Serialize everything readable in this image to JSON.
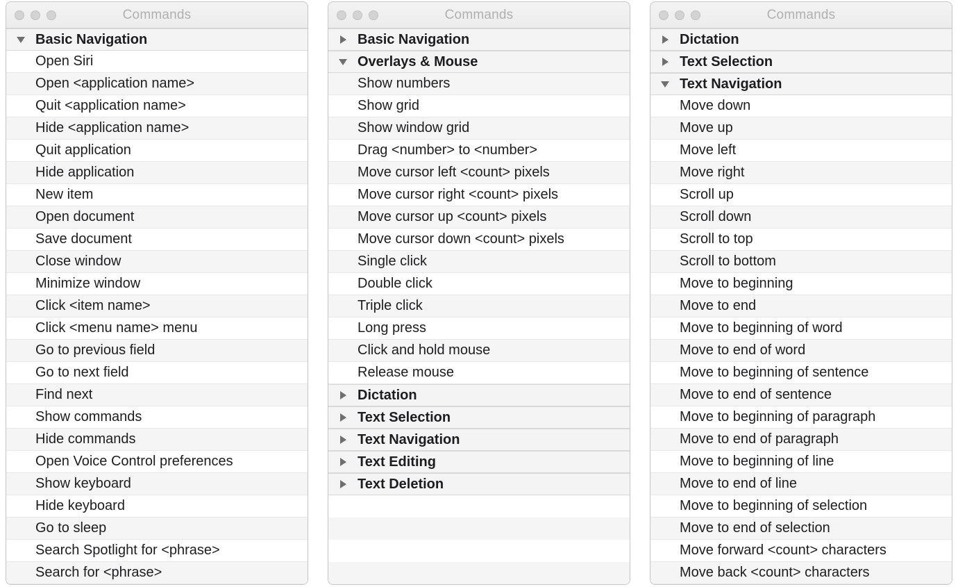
{
  "windowTitle": "Commands",
  "panels": [
    {
      "title": "Commands",
      "sections": [
        {
          "label": "Basic Navigation",
          "expanded": true,
          "items": [
            "Open Siri",
            "Open <application name>",
            "Quit <application name>",
            "Hide <application name>",
            "Quit application",
            "Hide application",
            "New item",
            "Open document",
            "Save document",
            "Close window",
            "Minimize window",
            "Click <item name>",
            "Click <menu name> menu",
            "Go to previous field",
            "Go to next field",
            "Find next",
            "Show commands",
            "Hide commands",
            "Open Voice Control preferences",
            "Show keyboard",
            "Hide keyboard",
            "Go to sleep",
            "Search Spotlight for <phrase>",
            "Search for <phrase>"
          ]
        }
      ]
    },
    {
      "title": "Commands",
      "sections": [
        {
          "label": "Basic Navigation",
          "expanded": false,
          "items": []
        },
        {
          "label": "Overlays & Mouse",
          "expanded": true,
          "items": [
            "Show numbers",
            "Show grid",
            "Show window grid",
            "Drag <number> to <number>",
            "Move cursor left <count> pixels",
            "Move cursor right <count> pixels",
            "Move cursor up <count> pixels",
            "Move cursor down <count> pixels",
            "Single click",
            "Double click",
            "Triple click",
            "Long press",
            "Click and hold mouse",
            "Release mouse"
          ]
        },
        {
          "label": "Dictation",
          "expanded": false,
          "items": []
        },
        {
          "label": "Text Selection",
          "expanded": false,
          "items": []
        },
        {
          "label": "Text Navigation",
          "expanded": false,
          "items": []
        },
        {
          "label": "Text Editing",
          "expanded": false,
          "items": []
        },
        {
          "label": "Text Deletion",
          "expanded": false,
          "items": []
        }
      ]
    },
    {
      "title": "Commands",
      "sections": [
        {
          "label": "Dictation",
          "expanded": false,
          "items": []
        },
        {
          "label": "Text Selection",
          "expanded": false,
          "items": []
        },
        {
          "label": "Text Navigation",
          "expanded": true,
          "items": [
            "Move down",
            "Move up",
            "Move left",
            "Move right",
            "Scroll up",
            "Scroll down",
            "Scroll to top",
            "Scroll to bottom",
            "Move to beginning",
            "Move to end",
            "Move to beginning of word",
            "Move to end of word",
            "Move to beginning of sentence",
            "Move to end of sentence",
            "Move to beginning of paragraph",
            "Move to end of paragraph",
            "Move to beginning of line",
            "Move to end of line",
            "Move to beginning of selection",
            "Move to end of selection",
            "Move forward <count> characters",
            "Move back <count> characters"
          ]
        }
      ]
    }
  ]
}
